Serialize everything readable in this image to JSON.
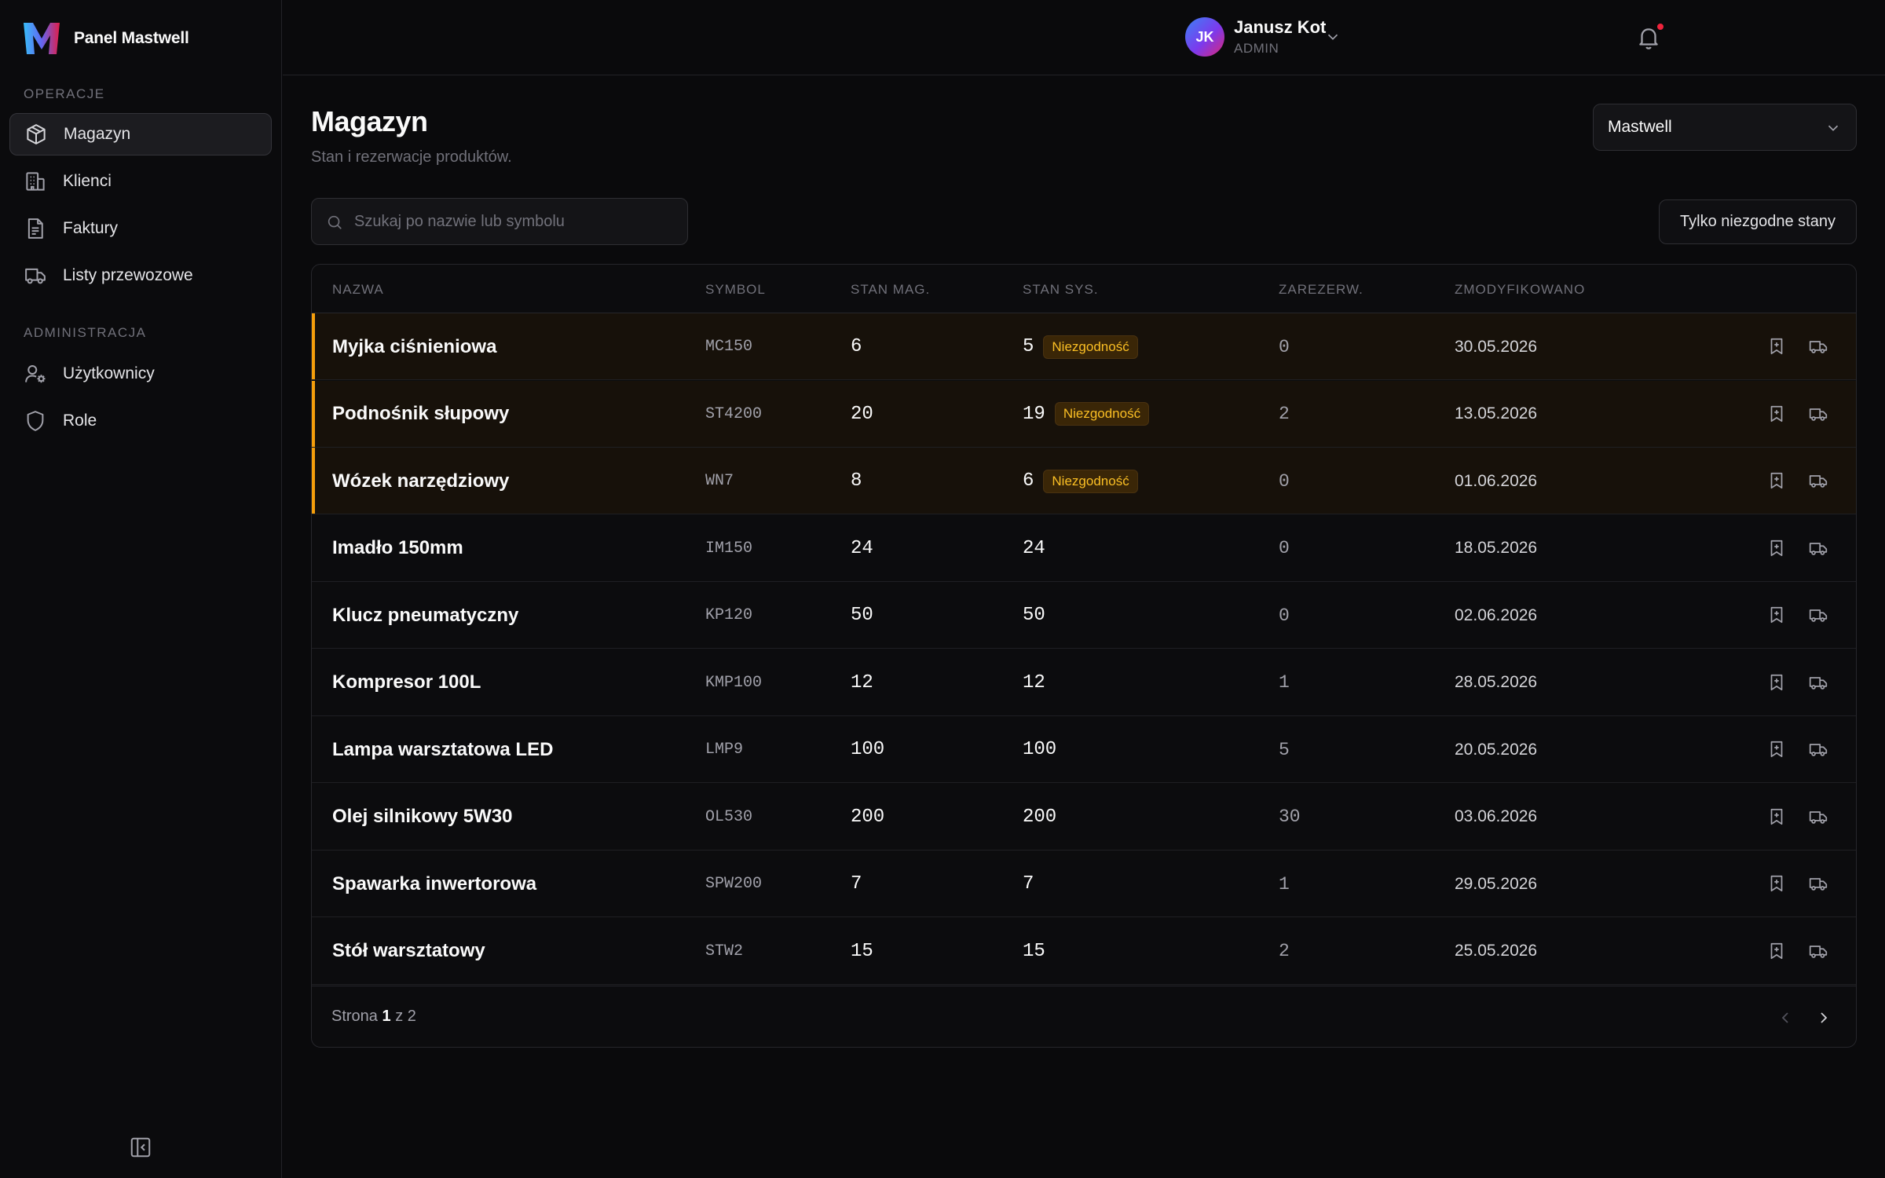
{
  "brand": {
    "name": "Panel Mastwell"
  },
  "sidebar": {
    "sections": [
      {
        "label": "OPERACJE"
      },
      {
        "label": "ADMINISTRACJA"
      }
    ],
    "items": [
      {
        "label": "Magazyn",
        "icon": "box-icon",
        "active": true
      },
      {
        "label": "Klienci",
        "icon": "building-icon"
      },
      {
        "label": "Faktury",
        "icon": "invoice-icon"
      },
      {
        "label": "Listy przewozowe",
        "icon": "truck-icon"
      },
      {
        "label": "Użytkownicy",
        "icon": "user-settings-icon"
      },
      {
        "label": "Role",
        "icon": "shield-icon"
      }
    ]
  },
  "topbar": {
    "user": {
      "initials": "JK",
      "name": "Janusz Kot",
      "role": "ADMIN"
    },
    "notification_dot_color": "#ef233c"
  },
  "page": {
    "title": "Magazyn",
    "subtitle": "Stan i rezerwacje produktów.",
    "company_select": "Mastwell",
    "search_placeholder": "Szukaj po nazwie lub symbolu",
    "filter_label": "Tylko niezgodne stany"
  },
  "table": {
    "columns": [
      "NAZWA",
      "SYMBOL",
      "STAN MAG.",
      "STAN SYS.",
      "ZAREZERW.",
      "ZMODYFIKOWANO"
    ],
    "rows": [
      {
        "name": "Myjka ciśnieniowa",
        "symbol": "MC150",
        "stan_mag": "6",
        "stan_sys": "5",
        "badge": "Niezgodność",
        "reserved": "0",
        "modified": "30.05.2026"
      },
      {
        "name": "Podnośnik słupowy",
        "symbol": "ST4200",
        "stan_mag": "20",
        "stan_sys": "19",
        "badge": "Niezgodność",
        "reserved": "2",
        "modified": "13.05.2026"
      },
      {
        "name": "Wózek narzędziowy",
        "symbol": "WN7",
        "stan_mag": "8",
        "stan_sys": "6",
        "badge": "Niezgodność",
        "reserved": "0",
        "modified": "01.06.2026"
      },
      {
        "name": "Imadło 150mm",
        "symbol": "IM150",
        "stan_mag": "24",
        "stan_sys": "24",
        "badge": "",
        "reserved": "0",
        "modified": "18.05.2026"
      },
      {
        "name": "Klucz pneumatyczny",
        "symbol": "KP120",
        "stan_mag": "50",
        "stan_sys": "50",
        "badge": "",
        "reserved": "0",
        "modified": "02.06.2026"
      },
      {
        "name": "Kompresor 100L",
        "symbol": "KMP100",
        "stan_mag": "12",
        "stan_sys": "12",
        "badge": "",
        "reserved": "1",
        "modified": "28.05.2026"
      },
      {
        "name": "Lampa warsztatowa LED",
        "symbol": "LMP9",
        "stan_mag": "100",
        "stan_sys": "100",
        "badge": "",
        "reserved": "5",
        "modified": "20.05.2026"
      },
      {
        "name": "Olej silnikowy 5W30",
        "symbol": "OL530",
        "stan_mag": "200",
        "stan_sys": "200",
        "badge": "",
        "reserved": "30",
        "modified": "03.06.2026"
      },
      {
        "name": "Spawarka inwertorowa",
        "symbol": "SPW200",
        "stan_mag": "7",
        "stan_sys": "7",
        "badge": "",
        "reserved": "1",
        "modified": "29.05.2026"
      },
      {
        "name": "Stół warsztatowy",
        "symbol": "STW2",
        "stan_mag": "15",
        "stan_sys": "15",
        "badge": "",
        "reserved": "2",
        "modified": "25.05.2026"
      }
    ],
    "row_actions": [
      "reserve-icon",
      "shipment-icon"
    ],
    "pagination": {
      "prefix": "Strona",
      "current": "1",
      "separator": "z",
      "total": "2"
    }
  },
  "colors": {
    "accent_warning": "#f59e0b",
    "badge_text": "#fbbf24"
  }
}
